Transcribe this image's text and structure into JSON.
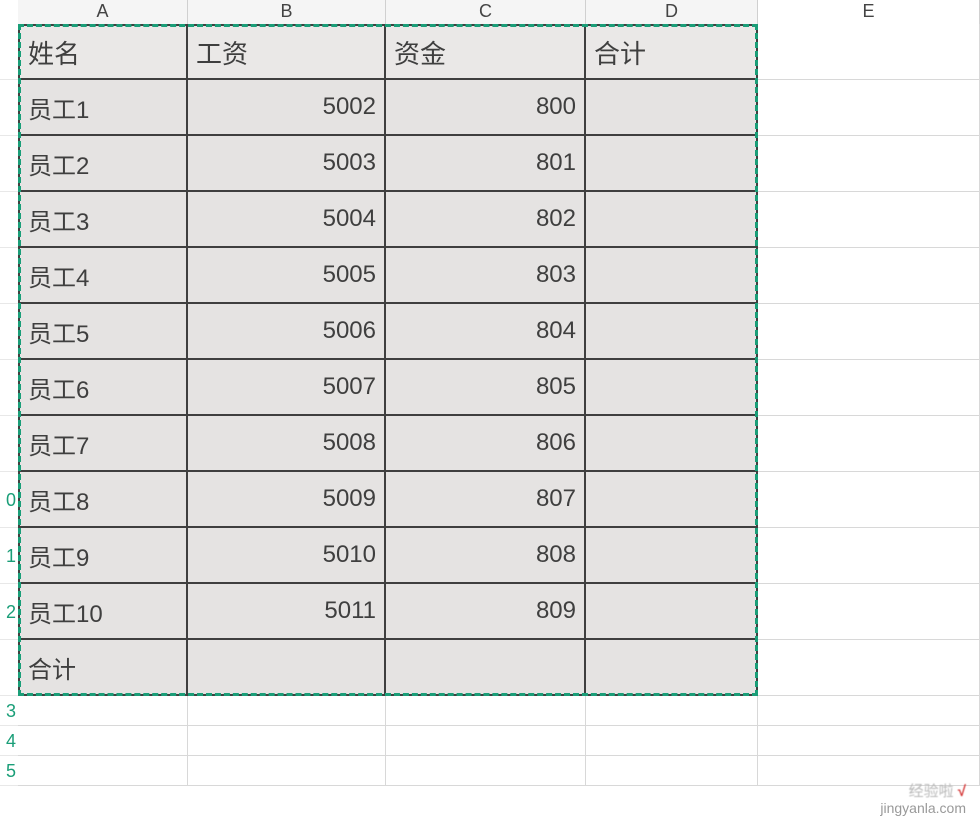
{
  "columns": {
    "A": "A",
    "B": "B",
    "C": "C",
    "D": "D",
    "E": "E"
  },
  "row_labels": [
    "0",
    "1",
    "2",
    "3",
    "4",
    "5"
  ],
  "table": {
    "headers": {
      "name": "姓名",
      "salary": "工资",
      "bonus": "资金",
      "total": "合计"
    },
    "rows": [
      {
        "name": "员工1",
        "salary": "5002",
        "bonus": "800",
        "total": ""
      },
      {
        "name": "员工2",
        "salary": "5003",
        "bonus": "801",
        "total": ""
      },
      {
        "name": "员工3",
        "salary": "5004",
        "bonus": "802",
        "total": ""
      },
      {
        "name": "员工4",
        "salary": "5005",
        "bonus": "803",
        "total": ""
      },
      {
        "name": "员工5",
        "salary": "5006",
        "bonus": "804",
        "total": ""
      },
      {
        "name": "员工6",
        "salary": "5007",
        "bonus": "805",
        "total": ""
      },
      {
        "name": "员工7",
        "salary": "5008",
        "bonus": "806",
        "total": ""
      },
      {
        "name": "员工8",
        "salary": "5009",
        "bonus": "807",
        "total": ""
      },
      {
        "name": "员工9",
        "salary": "5010",
        "bonus": "808",
        "total": ""
      },
      {
        "name": "员工10",
        "salary": "5011",
        "bonus": "809",
        "total": ""
      }
    ],
    "footer": {
      "name": "合计",
      "salary": "",
      "bonus": "",
      "total": ""
    }
  },
  "watermark": {
    "line1": "经验啦",
    "line2": "jingyanla.com"
  },
  "chart_data": {
    "type": "table",
    "title": "",
    "columns": [
      "姓名",
      "工资",
      "资金",
      "合计"
    ],
    "rows": [
      [
        "员工1",
        5002,
        800,
        null
      ],
      [
        "员工2",
        5003,
        801,
        null
      ],
      [
        "员工3",
        5004,
        802,
        null
      ],
      [
        "员工4",
        5005,
        803,
        null
      ],
      [
        "员工5",
        5006,
        804,
        null
      ],
      [
        "员工6",
        5007,
        805,
        null
      ],
      [
        "员工7",
        5008,
        806,
        null
      ],
      [
        "员工8",
        5009,
        807,
        null
      ],
      [
        "员工9",
        5010,
        808,
        null
      ],
      [
        "员工10",
        5011,
        809,
        null
      ],
      [
        "合计",
        null,
        null,
        null
      ]
    ]
  }
}
